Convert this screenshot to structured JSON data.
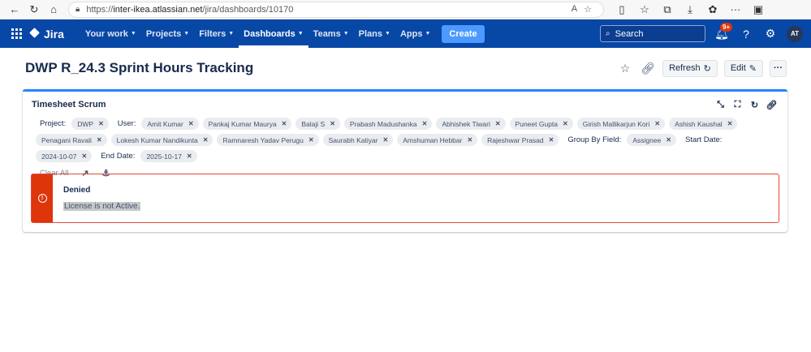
{
  "browser": {
    "url_prefix": "https://",
    "url_host": "inter-ikea.atlassian.net",
    "url_path": "/jira/dashboards/10170"
  },
  "nav": {
    "logo": "Jira",
    "items": [
      "Your work",
      "Projects",
      "Filters",
      "Dashboards",
      "Teams",
      "Plans",
      "Apps"
    ],
    "active": "Dashboards",
    "create": "Create",
    "search_placeholder": "Search",
    "notifications_badge": "9+",
    "avatar_initials": "AT"
  },
  "page": {
    "title": "DWP R_24.3 Sprint Hours Tracking",
    "refresh_label": "Refresh",
    "edit_label": "Edit",
    "more_label": "···"
  },
  "gadget": {
    "title": "Timesheet Scrum",
    "project_label": "Project:",
    "project_chips": [
      "DWP"
    ],
    "user_label": "User:",
    "user_chips_row1": [
      "Amit Kumar",
      "Pankaj Kumar Maurya",
      "Balaji S",
      "Prabash Madushanka",
      "Abhishek Tiwari",
      "Puneet Gupta",
      "Girish Mallikarjun Kori",
      "Ashish Kaushal",
      "Penagani Ravali"
    ],
    "user_chips_row2": [
      "Lokesh Kumar Nandikunta",
      "Ramnaresh Yadav Perugu",
      "Saurabh Katiyar",
      "Amshuman Hebbar",
      "Rajeshwar Prasad"
    ],
    "group_label": "Group By Field:",
    "group_chip": "Assignee",
    "start_label": "Start Date:",
    "start_chip": "2024-10-07",
    "end_label": "End Date:",
    "end_chip": "2025-10-17",
    "clear_all": "Clear All",
    "error_title": "Denied",
    "error_message": "License is not Active."
  },
  "colors": {
    "nav_bg": "#0747a6",
    "create_bg": "#4c9aff",
    "error": "#de350b",
    "gadget_accent": "#2684ff"
  }
}
